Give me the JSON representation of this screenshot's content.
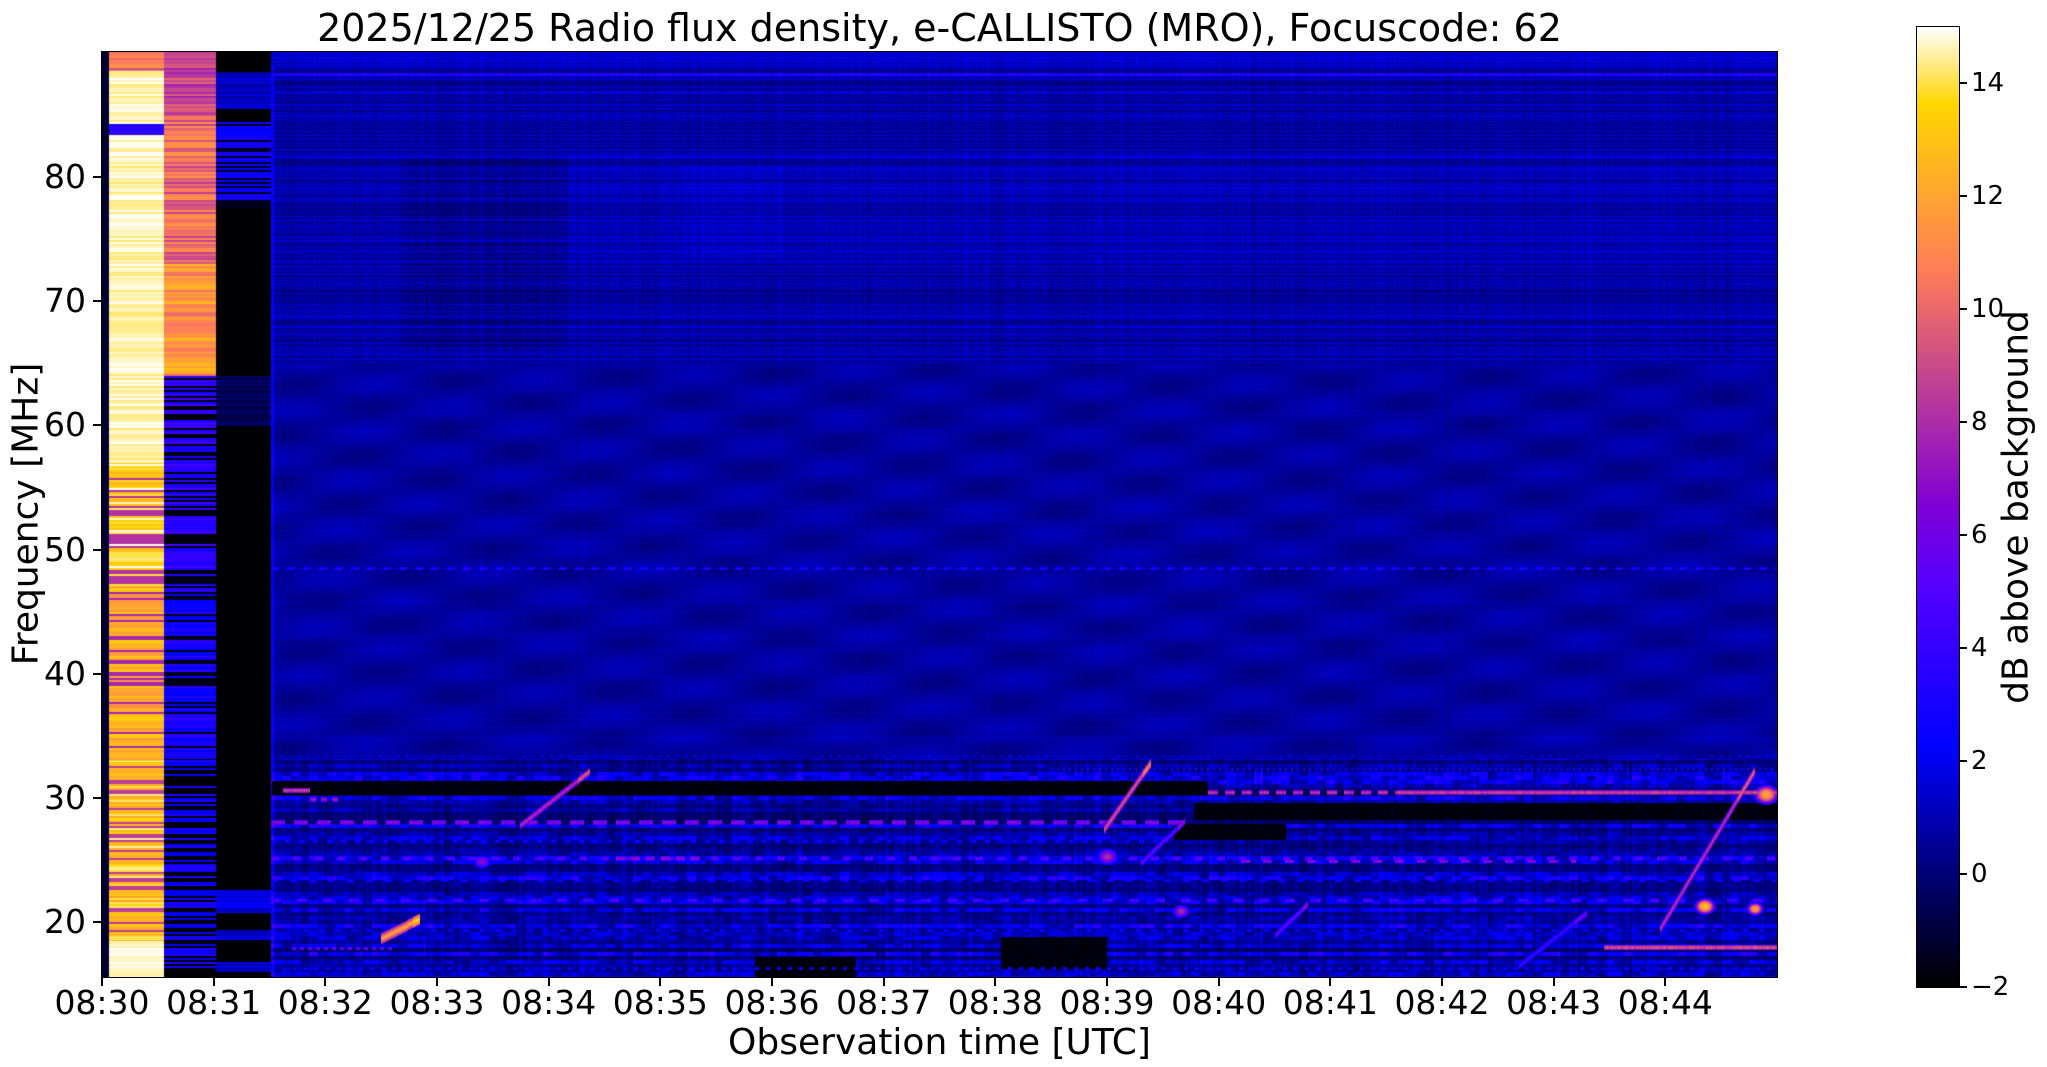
{
  "figure": {
    "title": "2025/12/25  Radio flux density, e-CALLISTO (MRO), Focuscode: 62",
    "xlabel": "Observation time [UTC]",
    "ylabel": "Frequency [MHz]",
    "colorbar_label": "dB above background"
  },
  "chart_data": {
    "type": "heatmap",
    "title": "2025/12/25  Radio flux density, e-CALLISTO (MRO), Focuscode: 62",
    "xlabel": "Observation time [UTC]",
    "ylabel": "Frequency [MHz]",
    "x_ticks": [
      "08:30",
      "08:31",
      "08:32",
      "08:33",
      "08:34",
      "08:35",
      "08:36",
      "08:37",
      "08:38",
      "08:39",
      "08:40",
      "08:41",
      "08:42",
      "08:43",
      "08:44"
    ],
    "y_ticks": [
      80,
      70,
      60,
      50,
      40,
      30,
      20
    ],
    "x_start_utc": "08:30",
    "x_end_utc": "08:45",
    "x_span_minutes": 15,
    "freq_top_mhz": 90.06,
    "freq_bottom_mhz": 15.58,
    "grid": false,
    "colorbar": {
      "label": "dB above background",
      "tick_labels": [
        "14",
        "12",
        "10",
        "8",
        "6",
        "4",
        "2",
        "0",
        "−2"
      ],
      "tick_values": [
        14,
        12,
        10,
        8,
        6,
        4,
        2,
        0,
        -2
      ],
      "vmin": -2,
      "vmax": 15,
      "colormap": "gnuplot2"
    },
    "calibration_bands": [
      {
        "name": "noise-source-bright",
        "t0": 0.055,
        "t1": 0.55
      },
      {
        "name": "noise-source-attenuated",
        "t0": 0.55,
        "t1": 1.02
      },
      {
        "name": "receiver-off-dark",
        "t0": 1.02,
        "t1": 1.51
      }
    ],
    "hlines": [
      {
        "f": 88.25,
        "t0": 1.51,
        "t1": 15,
        "v": 4.0,
        "w": 3
      },
      {
        "f": 86.8,
        "t0": 1.51,
        "t1": 15,
        "v": 2.2,
        "w": 2
      },
      {
        "f": 84.9,
        "t0": 1.51,
        "t1": 15,
        "v": 1.7,
        "w": 2
      },
      {
        "f": 81.6,
        "t0": 1.51,
        "t1": 15,
        "v": 1.9,
        "w": 2
      },
      {
        "f": 79.9,
        "t0": 1.51,
        "t1": 15,
        "v": 1.6,
        "w": 2
      },
      {
        "f": 78.3,
        "t0": 1.51,
        "t1": 15,
        "v": 1.8,
        "w": 2
      },
      {
        "f": 76.6,
        "t0": 1.51,
        "t1": 15,
        "v": 1.5,
        "w": 2
      },
      {
        "f": 74.9,
        "t0": 1.51,
        "t1": 15,
        "v": 1.7,
        "w": 2
      },
      {
        "f": 73.2,
        "t0": 1.51,
        "t1": 15,
        "v": 1.5,
        "w": 2
      },
      {
        "f": 71.5,
        "t0": 1.51,
        "t1": 15,
        "v": 1.6,
        "w": 2
      },
      {
        "f": 69.8,
        "t0": 1.51,
        "t1": 15,
        "v": 1.4,
        "w": 2
      },
      {
        "f": 68.0,
        "t0": 1.51,
        "t1": 15,
        "v": 1.5,
        "w": 2
      },
      {
        "f": 66.2,
        "t0": 1.51,
        "t1": 15,
        "v": 1.4,
        "w": 2
      },
      {
        "f": 48.55,
        "t0": 1.51,
        "t1": 15,
        "v": 3.6,
        "w": 3,
        "dash": [
          8,
          8
        ]
      },
      {
        "f": 33.4,
        "t0": 1.51,
        "t1": 15,
        "v": 2.2,
        "w": 2,
        "dash": [
          3,
          6
        ]
      },
      {
        "f": 32.3,
        "t0": 8.5,
        "t1": 15,
        "v": 3.5,
        "w": 3,
        "dash": [
          2,
          4
        ]
      },
      {
        "f": 30.6,
        "t0": 1.62,
        "t1": 1.86,
        "v": 9,
        "w": 5
      },
      {
        "f": 29.9,
        "t0": 1.86,
        "t1": 2.15,
        "v": 7.5,
        "w": 4,
        "dash": [
          6,
          5
        ]
      },
      {
        "f": 30.5,
        "t0": 9.9,
        "t1": 11.6,
        "v": 8.5,
        "w": 4,
        "dash": [
          10,
          7
        ]
      },
      {
        "f": 30.5,
        "t0": 11.6,
        "t1": 15,
        "v": 9,
        "w": 4
      },
      {
        "f": 28.1,
        "t0": 1.51,
        "t1": 9.75,
        "v": 7,
        "w": 4,
        "dash": [
          14,
          9
        ]
      },
      {
        "f": 26.5,
        "t0": 1.51,
        "t1": 9.5,
        "v": 3.2,
        "w": 3,
        "dash": [
          5,
          9
        ]
      },
      {
        "f": 25.2,
        "t0": 1.51,
        "t1": 15,
        "v": 5.5,
        "w": 4,
        "dash": [
          8,
          14
        ]
      },
      {
        "f": 25.2,
        "t0": 4.6,
        "t1": 5.4,
        "v": 7,
        "w": 4,
        "dash": [
          9,
          6
        ]
      },
      {
        "f": 24.9,
        "t0": 10.2,
        "t1": 13.2,
        "v": 7,
        "w": 3,
        "dash": [
          9,
          13
        ]
      },
      {
        "f": 23.4,
        "t0": 1.51,
        "t1": 15,
        "v": 3,
        "w": 3,
        "dash": [
          7,
          12
        ]
      },
      {
        "f": 21.8,
        "t0": 1.51,
        "t1": 15,
        "v": 5,
        "w": 4,
        "dash": [
          10,
          16
        ]
      },
      {
        "f": 19.4,
        "t0": 1.51,
        "t1": 15,
        "v": 2.8,
        "w": 3,
        "dash": [
          6,
          10
        ]
      },
      {
        "f": 18.0,
        "t0": 13.45,
        "t1": 15,
        "v": 9.5,
        "w": 5
      },
      {
        "f": 17.9,
        "t0": 1.7,
        "t1": 2.6,
        "v": 6,
        "w": 3,
        "dash": [
          4,
          4
        ]
      },
      {
        "f": 16.3,
        "t0": 1.51,
        "t1": 15,
        "v": 3,
        "w": 3,
        "dash": [
          4,
          7
        ]
      }
    ],
    "blocks_black": [
      {
        "t0": 1.52,
        "t1": 9.9,
        "f0": 30.2,
        "f1": 31.4
      },
      {
        "t0": 9.78,
        "t1": 15,
        "f0": 28.2,
        "f1": 29.6
      },
      {
        "t0": 9.6,
        "t1": 10.6,
        "f0": 26.6,
        "f1": 27.9
      },
      {
        "t0": 5.85,
        "t1": 6.75,
        "f0": 15.6,
        "f1": 17.2
      },
      {
        "t0": 8.05,
        "t1": 9.0,
        "f0": 16.2,
        "f1": 18.8
      }
    ],
    "blocks_delta": [
      {
        "t0": 2.68,
        "t1": 4.17,
        "f0": 66,
        "f1": 81.5,
        "dv": -0.35
      },
      {
        "t0": 4.17,
        "t1": 15,
        "f0": 73,
        "f1": 82,
        "dv": 0.18
      },
      {
        "t0": 5.2,
        "t1": 6.1,
        "f0": 73.5,
        "f1": 81,
        "dv": 0.25
      }
    ],
    "diagonals": [
      {
        "t0": 3.74,
        "f0": 27.8,
        "t1": 4.37,
        "f1": 32.2,
        "v": 8,
        "w": 3
      },
      {
        "t0": 8.97,
        "f0": 27.5,
        "t1": 9.39,
        "f1": 32.9,
        "v": 9.5,
        "w": 4
      },
      {
        "t0": 9.3,
        "f0": 24.8,
        "t1": 9.7,
        "f1": 28.2,
        "v": 5.5,
        "w": 3
      },
      {
        "t0": 13.95,
        "f0": 19.5,
        "t1": 14.8,
        "f1": 32.3,
        "v": 8.5,
        "w": 4
      },
      {
        "t0": 12.69,
        "f0": 16.5,
        "t1": 13.3,
        "f1": 20.8,
        "v": 4.5,
        "w": 3
      },
      {
        "t0": 10.5,
        "f0": 19.0,
        "t1": 10.8,
        "f1": 21.5,
        "v": 5.5,
        "w": 3
      },
      {
        "t0": 2.5,
        "f0": 18.7,
        "t1": 2.85,
        "f1": 20.3,
        "v": 12,
        "w": 5
      }
    ],
    "blobs": [
      {
        "t": 14.35,
        "f": 21.3,
        "v": 13,
        "r": 5
      },
      {
        "t": 14.8,
        "f": 21.1,
        "v": 12,
        "r": 4
      },
      {
        "t": 14.9,
        "f": 30.3,
        "v": 12,
        "r": 6
      },
      {
        "t": 9.0,
        "f": 25.3,
        "v": 8,
        "r": 5
      },
      {
        "t": 9.66,
        "f": 20.9,
        "v": 8,
        "r": 4
      },
      {
        "t": 3.4,
        "f": 24.9,
        "v": 7,
        "r": 4
      }
    ],
    "background_zones": {
      "top_band_min_f": 89.0,
      "upper_band_min_f": 65.0,
      "mid_band_min_f": 33.2,
      "note_upper": "dark blue with horizontal banding and vertical flicker",
      "note_mid": "very dark blue with diagonal interference waves",
      "note_low": "bright speckled RFI band below 33 MHz"
    }
  }
}
